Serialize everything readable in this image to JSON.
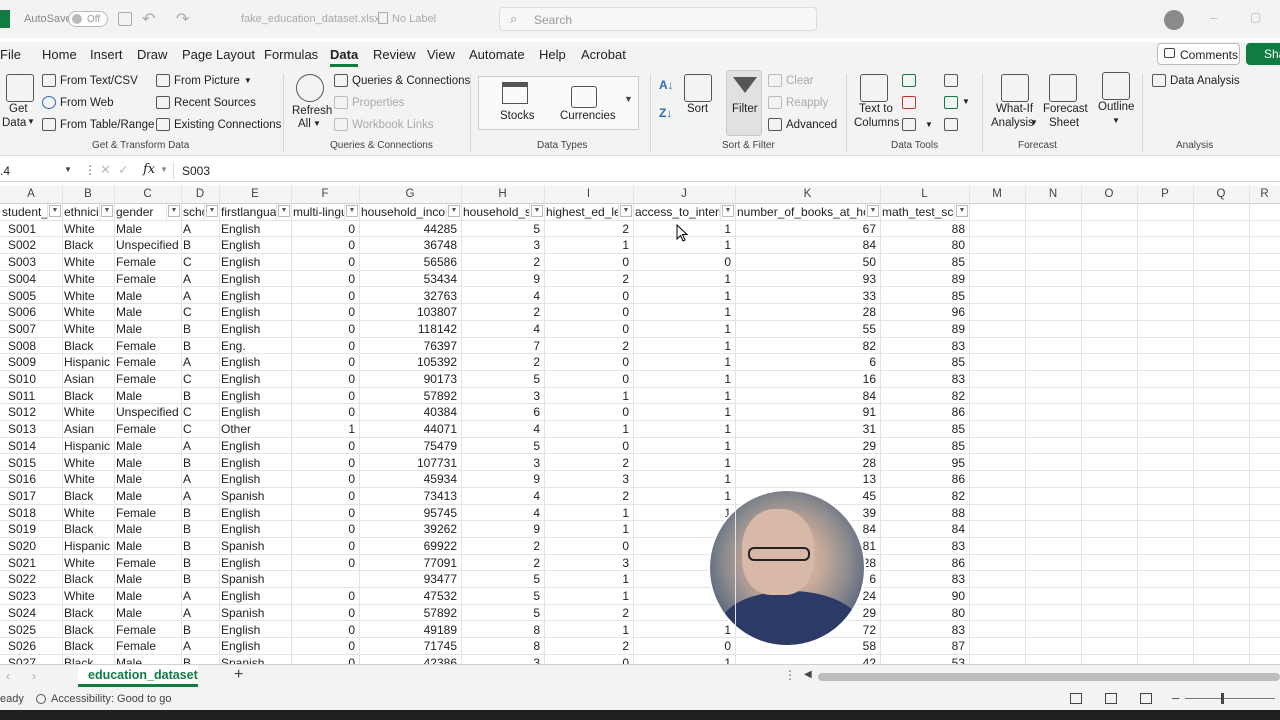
{
  "title": {
    "autosave": "AutoSave",
    "autosave_state": "Off",
    "filename": "fake_education_dataset.xlsx",
    "label": "No Label",
    "search_placeholder": "Search"
  },
  "tabs": [
    "File",
    "Home",
    "Insert",
    "Draw",
    "Page Layout",
    "Formulas",
    "Data",
    "Review",
    "View",
    "Automate",
    "Help",
    "Acrobat"
  ],
  "active_tab": "Data",
  "comments_label": "Comments",
  "share_label": "Sha",
  "ribbon": {
    "get_data": "Get",
    "get_data2": "Data",
    "from_text_csv": "From Text/CSV",
    "from_web": "From Web",
    "from_table_range": "From Table/Range",
    "from_picture": "From Picture",
    "recent_sources": "Recent Sources",
    "existing_connections": "Existing Connections",
    "group_get_transform": "Get & Transform Data",
    "refresh_all": "Refresh",
    "refresh_all2": "All",
    "queries_connections": "Queries & Connections",
    "properties": "Properties",
    "workbook_links": "Workbook Links",
    "group_queries": "Queries & Connections",
    "stocks": "Stocks",
    "currencies": "Currencies",
    "group_data_types": "Data Types",
    "sort": "Sort",
    "filter": "Filter",
    "clear": "Clear",
    "reapply": "Reapply",
    "advanced": "Advanced",
    "group_sort_filter": "Sort & Filter",
    "text_to_columns": "Text to",
    "text_to_columns2": "Columns",
    "group_data_tools": "Data Tools",
    "what_if": "What-If",
    "what_if2": "Analysis",
    "forecast_sheet": "Forecast",
    "forecast_sheet2": "Sheet",
    "group_forecast": "Forecast",
    "outline": "Outline",
    "data_analysis": "Data Analysis",
    "group_analysis": "Analysis"
  },
  "formula_bar": {
    "name_box": ".4",
    "fx": "fx",
    "value": "S003"
  },
  "columns": [
    "A",
    "B",
    "C",
    "D",
    "E",
    "F",
    "G",
    "H",
    "I",
    "J",
    "K",
    "L",
    "M",
    "N",
    "O",
    "P",
    "Q",
    "R"
  ],
  "headers": [
    "student_",
    "ethnici",
    "gender",
    "scho",
    "firstlangua",
    "multi-lingu",
    "household_incon",
    "household_si",
    "highest_ed_lev",
    "access_to_intern",
    "number_of_books_at_hon",
    "math_test_sco"
  ],
  "rows": [
    [
      "S001",
      "White",
      "Male",
      "A",
      "English",
      "0",
      "44285",
      "5",
      "2",
      "1",
      "67",
      "88"
    ],
    [
      "S002",
      "Black",
      "Unspecified",
      "B",
      "English",
      "0",
      "36748",
      "3",
      "1",
      "1",
      "84",
      "80"
    ],
    [
      "S003",
      "White",
      "Female",
      "C",
      "English",
      "0",
      "56586",
      "2",
      "0",
      "0",
      "50",
      "85"
    ],
    [
      "S004",
      "White",
      "Female",
      "A",
      "English",
      "0",
      "53434",
      "9",
      "2",
      "1",
      "93",
      "89"
    ],
    [
      "S005",
      "White",
      "Male",
      "A",
      "English",
      "0",
      "32763",
      "4",
      "0",
      "1",
      "33",
      "85"
    ],
    [
      "S006",
      "White",
      "Male",
      "C",
      "English",
      "0",
      "103807",
      "2",
      "0",
      "1",
      "28",
      "96"
    ],
    [
      "S007",
      "White",
      "Male",
      "B",
      "English",
      "0",
      "118142",
      "4",
      "0",
      "1",
      "55",
      "89"
    ],
    [
      "S008",
      "Black",
      "Female",
      "B",
      "Eng.",
      "0",
      "76397",
      "7",
      "2",
      "1",
      "82",
      "83"
    ],
    [
      "S009",
      "Hispanic",
      "Female",
      "A",
      "English",
      "0",
      "105392",
      "2",
      "0",
      "1",
      "6",
      "85"
    ],
    [
      "S010",
      "Asian",
      "Female",
      "C",
      "English",
      "0",
      "90173",
      "5",
      "0",
      "1",
      "16",
      "83"
    ],
    [
      "S011",
      "Black",
      "Male",
      "B",
      "English",
      "0",
      "57892",
      "3",
      "1",
      "1",
      "84",
      "82"
    ],
    [
      "S012",
      "White",
      "Unspecified",
      "C",
      "English",
      "0",
      "40384",
      "6",
      "0",
      "1",
      "91",
      "86"
    ],
    [
      "S013",
      "Asian",
      "Female",
      "C",
      "Other",
      "1",
      "44071",
      "4",
      "1",
      "1",
      "31",
      "85"
    ],
    [
      "S014",
      "Hispanic",
      "Male",
      "A",
      "English",
      "0",
      "75479",
      "5",
      "0",
      "1",
      "29",
      "85"
    ],
    [
      "S015",
      "White",
      "Male",
      "B",
      "English",
      "0",
      "107731",
      "3",
      "2",
      "1",
      "28",
      "95"
    ],
    [
      "S016",
      "White",
      "Male",
      "A",
      "English",
      "0",
      "45934",
      "9",
      "3",
      "1",
      "13",
      "86"
    ],
    [
      "S017",
      "Black",
      "Male",
      "A",
      "Spanish",
      "0",
      "73413",
      "4",
      "2",
      "1",
      "45",
      "82"
    ],
    [
      "S018",
      "White",
      "Female",
      "B",
      "English",
      "0",
      "95745",
      "4",
      "1",
      "1",
      "39",
      "88"
    ],
    [
      "S019",
      "Black",
      "Male",
      "B",
      "English",
      "0",
      "39262",
      "9",
      "1",
      "",
      "84",
      "84"
    ],
    [
      "S020",
      "Hispanic",
      "Male",
      "B",
      "Spanish",
      "0",
      "69922",
      "2",
      "0",
      "",
      "81",
      "83"
    ],
    [
      "S021",
      "White",
      "Female",
      "B",
      "English",
      "0",
      "77091",
      "2",
      "3",
      "",
      "28",
      "86"
    ],
    [
      "S022",
      "Black",
      "Male",
      "B",
      "Spanish",
      "",
      "93477",
      "5",
      "1",
      "",
      "6",
      "83"
    ],
    [
      "S023",
      "White",
      "Male",
      "A",
      "English",
      "0",
      "47532",
      "5",
      "1",
      "",
      "24",
      "90"
    ],
    [
      "S024",
      "Black",
      "Male",
      "A",
      "Spanish",
      "0",
      "57892",
      "5",
      "2",
      "",
      "29",
      "80"
    ],
    [
      "S025",
      "Black",
      "Female",
      "B",
      "English",
      "0",
      "49189",
      "8",
      "1",
      "1",
      "72",
      "83"
    ],
    [
      "S026",
      "Black",
      "Female",
      "A",
      "English",
      "0",
      "71745",
      "8",
      "2",
      "0",
      "58",
      "87"
    ],
    [
      "S027",
      "Black",
      "Male",
      "B",
      "Spanish",
      "0",
      "42386",
      "3",
      "0",
      "1",
      "42",
      "53"
    ]
  ],
  "sheet_tab": "education_dataset",
  "status": {
    "ready": "eady",
    "accessibility": "Accessibility: Good to go"
  }
}
